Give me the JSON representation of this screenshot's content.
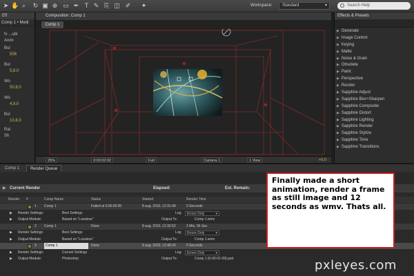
{
  "toolbar": {
    "workspace_label": "Workspace:",
    "workspace_value": "Standard",
    "search_placeholder": "Search Help"
  },
  "effect_controls": {
    "tab": "Eff",
    "sub": "Comp 1 • Medi",
    "rows": [
      {
        "label": "fx  ...ubl"
      },
      {
        "label": "Anim"
      },
      {
        "label": "Bul"
      },
      {
        "label": "508",
        "value": true
      },
      {
        "label": "Bul"
      },
      {
        "label": "5,8,0",
        "value": true
      },
      {
        "label": "Wo"
      },
      {
        "label": "50,8,0",
        "value": true
      },
      {
        "label": "Wo"
      },
      {
        "label": "4,8,0",
        "value": true
      },
      {
        "label": "Bul"
      },
      {
        "label": "10,8,0",
        "value": true
      },
      {
        "label": "Rai"
      },
      {
        "label": "Sh"
      }
    ]
  },
  "composition": {
    "title": "Composition: Comp 1",
    "tab": "Comp 1",
    "footer": {
      "zoom": "25%",
      "timecode": "0:00:02:02",
      "resolution": "Full",
      "camera": "Camera 1",
      "view": "1 View",
      "exposure": "+0.0"
    }
  },
  "effects_presets": {
    "title": "Effects & Presets",
    "items": [
      "Generate",
      "Image Control",
      "Keying",
      "Matte",
      "Noise & Grain",
      "Obsolete",
      "Paint",
      "Perspective",
      "Render",
      "Sapphire Adjust",
      "Sapphire Blur+Sharpen",
      "Sapphire Composite",
      "Sapphire Distort",
      "Sapphire Lighting",
      "Sapphire Render",
      "Sapphire Stylize",
      "Sapphire Time",
      "Sapphire Transitions"
    ]
  },
  "bottom_tabs": [
    "Comp 1",
    "Render Queue"
  ],
  "render_queue": {
    "current_render": "Current Render",
    "elapsed": "Elapsed:",
    "est_remain": "Est. Remain:",
    "columns": [
      "Render",
      "#",
      "Comp Name",
      "Status",
      "Started",
      "Render Time"
    ],
    "items": [
      {
        "num": "1",
        "comp": "Comp 1",
        "status": "Failed at 0:00:00:00",
        "started": "8 aug. 2010, 12:31:49",
        "time": "0 Seconds",
        "render_settings": "Best Settings",
        "log": "Errors Only",
        "output_module": "Based on \"Lossless\"",
        "output_to": "Comp 1.wmv"
      },
      {
        "num": "2",
        "comp": "Comp 1",
        "status": "Done",
        "started": "8 aug. 2010, 12:32:52",
        "time": "2 Min, 56 Sec",
        "render_settings": "Best Settings",
        "log": "Errors Only",
        "output_module": "Based on \"Lossless\"",
        "output_to": "Comp 1.wmv"
      },
      {
        "num": "3",
        "comp": "Comp 1",
        "status": "Done",
        "started": "8 aug. 2010, 12:46:24",
        "time": "0 Seconds",
        "render_settings": "Current Settings",
        "log": "Errors Only",
        "output_module": "Photoshop",
        "output_to": "Comp 1 (0-00-01-09).psd"
      }
    ],
    "labels": {
      "render_settings": "Render Settings:",
      "output_module": "Output Module:",
      "log": "Log:",
      "output_to": "Output To:"
    }
  },
  "annotation": "Finally made a short animation, render a frame as still image and 12 seconds as wmv. Thats all.",
  "watermark": "pxleyes.com",
  "colors": {
    "accent_gold": "#d6b35a",
    "guide_red": "#8b2a2a",
    "note_border": "#c42020"
  }
}
